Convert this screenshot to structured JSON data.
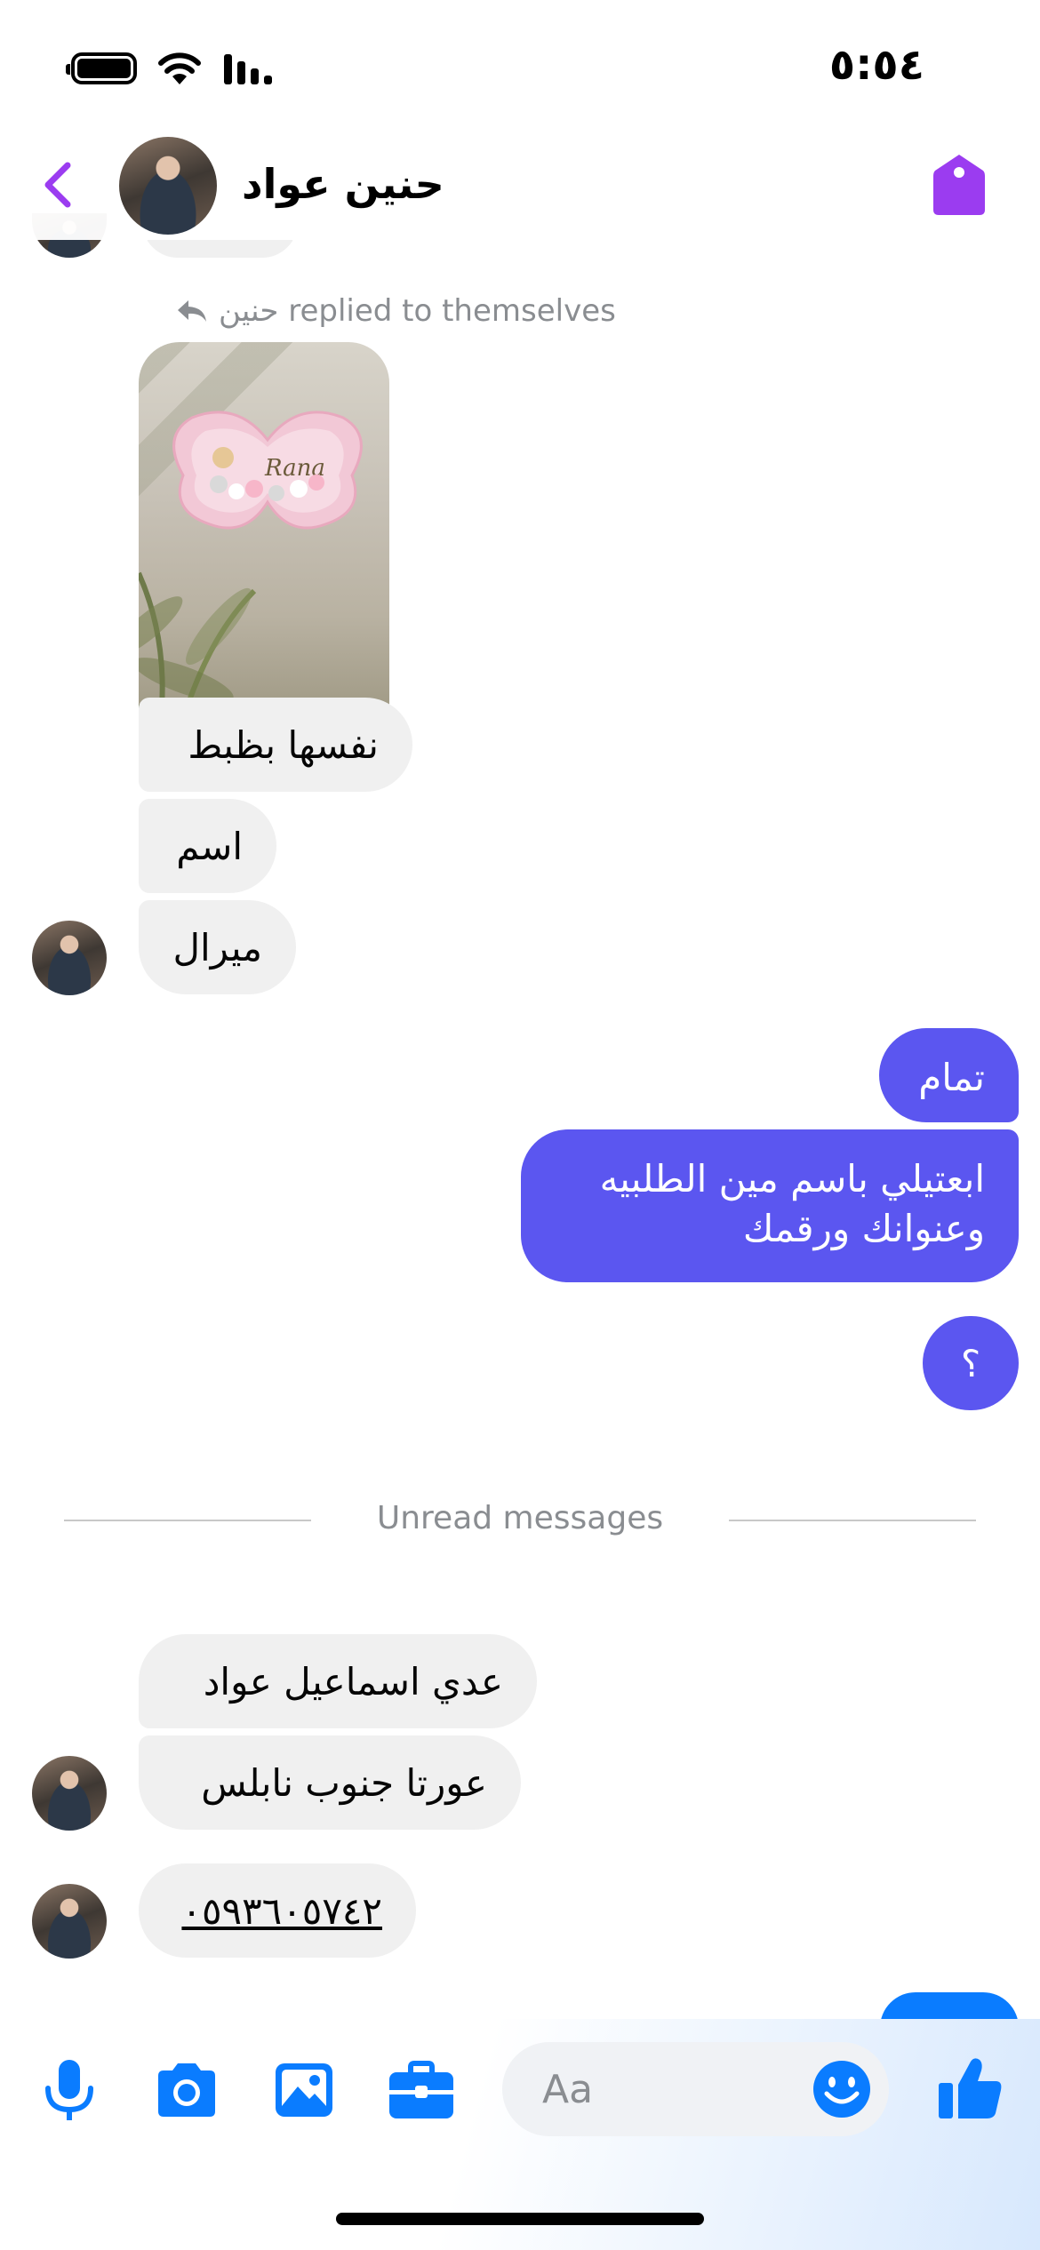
{
  "status_bar": {
    "time": "٥:٥٤"
  },
  "header": {
    "contact_name": "حنين عواد"
  },
  "reply_note": {
    "text": "حنين replied to themselves"
  },
  "messages_incoming_1": [
    {
      "text": "نفسها بظبط"
    },
    {
      "text": "اسم"
    },
    {
      "text": "ميرال"
    }
  ],
  "messages_outgoing": [
    {
      "text": "تمام"
    },
    {
      "text": "ابعتيلي باسم مين الطلبيه\nوعنوانك ورقمك"
    },
    {
      "text": "؟"
    }
  ],
  "divider": {
    "label": "Unread messages"
  },
  "messages_incoming_2": [
    {
      "text": "عدي اسماعيل عواد"
    },
    {
      "text": "عورتا جنوب نابلس"
    },
    {
      "text": "٠٥٩٣٦٠٥٧٤٢"
    }
  ],
  "photo": {
    "name_on_sign": "Rana"
  },
  "composer": {
    "placeholder": "Aa"
  },
  "colors": {
    "accent_purple": "#9b3cf0",
    "outgoing_bubble": "#5b56f0",
    "messenger_blue": "#0a7cff",
    "incoming_bubble": "#f0f0f0"
  },
  "icons": [
    "battery-icon",
    "wifi-icon",
    "signal-icon",
    "back-icon",
    "tag-icon",
    "reply-icon",
    "mic-icon",
    "camera-icon",
    "gallery-icon",
    "briefcase-icon",
    "emoji-icon",
    "like-icon"
  ]
}
